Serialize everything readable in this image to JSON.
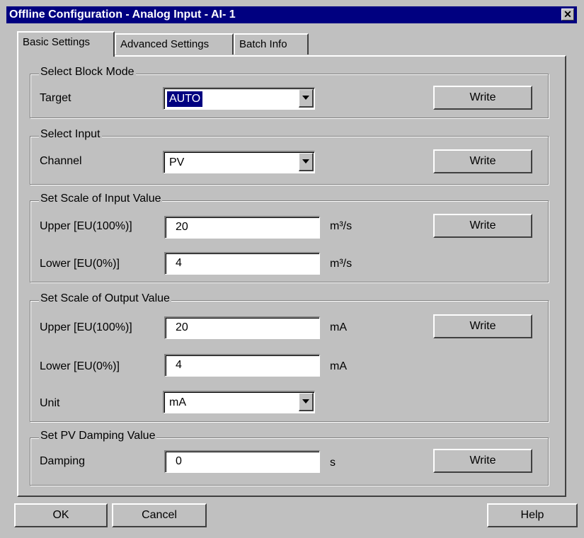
{
  "window": {
    "title": "Offline Configuration - Analog Input - AI- 1",
    "close_glyph": "✕"
  },
  "tabs": [
    {
      "label": "Basic Settings",
      "active": true
    },
    {
      "label": "Advanced Settings",
      "active": false
    },
    {
      "label": "Batch Info",
      "active": false
    }
  ],
  "block_mode": {
    "legend": "Select Block Mode",
    "target_label": "Target",
    "target_value": "AUTO",
    "write_label": "Write"
  },
  "input": {
    "legend": "Select Input",
    "channel_label": "Channel",
    "channel_value": "PV",
    "write_label": "Write"
  },
  "input_scale": {
    "legend": "Set Scale of Input Value",
    "upper_label": "Upper [EU(100%)]",
    "upper_value": "20",
    "upper_unit": "m³/s",
    "lower_label": "Lower [EU(0%)]",
    "lower_value": "4",
    "lower_unit": "m³/s",
    "write_label": "Write"
  },
  "output_scale": {
    "legend": "Set Scale of Output Value",
    "upper_label": "Upper [EU(100%)]",
    "upper_value": "20",
    "upper_unit": "mA",
    "lower_label": "Lower [EU(0%)]",
    "lower_value": "4",
    "lower_unit": "mA",
    "unit_label": "Unit",
    "unit_value": "mA",
    "write_label": "Write"
  },
  "damping": {
    "legend": "Set PV Damping Value",
    "label": "Damping",
    "value": "0",
    "unit": "s",
    "write_label": "Write"
  },
  "footer": {
    "ok": "OK",
    "cancel": "Cancel",
    "help": "Help"
  }
}
